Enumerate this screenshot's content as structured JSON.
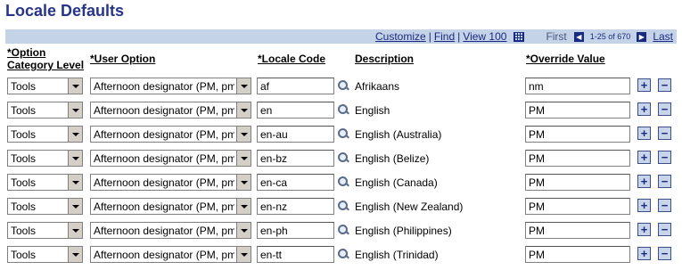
{
  "page": {
    "title": "Locale Defaults"
  },
  "grid_nav": {
    "customize": "Customize",
    "find": "Find",
    "view": "View 100",
    "first": "First",
    "range": "1-25 of 670",
    "last": "Last"
  },
  "columns": {
    "option_category": [
      "*Option",
      "Category Level"
    ],
    "user_option": "*User Option",
    "locale_code": "*Locale Code",
    "description": "Description",
    "override_value": "*Override Value"
  },
  "rows": [
    {
      "category": "Tools",
      "user_option": "Afternoon designator (PM, pm)",
      "locale_code": "af",
      "description": "Afrikaans",
      "override": "nm"
    },
    {
      "category": "Tools",
      "user_option": "Afternoon designator (PM, pm)",
      "locale_code": "en",
      "description": "English",
      "override": "PM"
    },
    {
      "category": "Tools",
      "user_option": "Afternoon designator (PM, pm)",
      "locale_code": "en-au",
      "description": "English (Australia)",
      "override": "PM"
    },
    {
      "category": "Tools",
      "user_option": "Afternoon designator (PM, pm)",
      "locale_code": "en-bz",
      "description": "English (Belize)",
      "override": "PM"
    },
    {
      "category": "Tools",
      "user_option": "Afternoon designator (PM, pm)",
      "locale_code": "en-ca",
      "description": "English (Canada)",
      "override": "PM"
    },
    {
      "category": "Tools",
      "user_option": "Afternoon designator (PM, pm)",
      "locale_code": "en-nz",
      "description": "English (New Zealand)",
      "override": "PM"
    },
    {
      "category": "Tools",
      "user_option": "Afternoon designator (PM, pm)",
      "locale_code": "en-ph",
      "description": "English (Philippines)",
      "override": "PM"
    },
    {
      "category": "Tools",
      "user_option": "Afternoon designator (PM, pm)",
      "locale_code": "en-tt",
      "description": "English (Trinidad)",
      "override": "PM"
    }
  ],
  "buttons": {
    "add": "+",
    "delete": "−"
  },
  "colors": {
    "title": "#26358a",
    "nav_bar": "#c4d3e8",
    "link": "#1a2a80"
  }
}
